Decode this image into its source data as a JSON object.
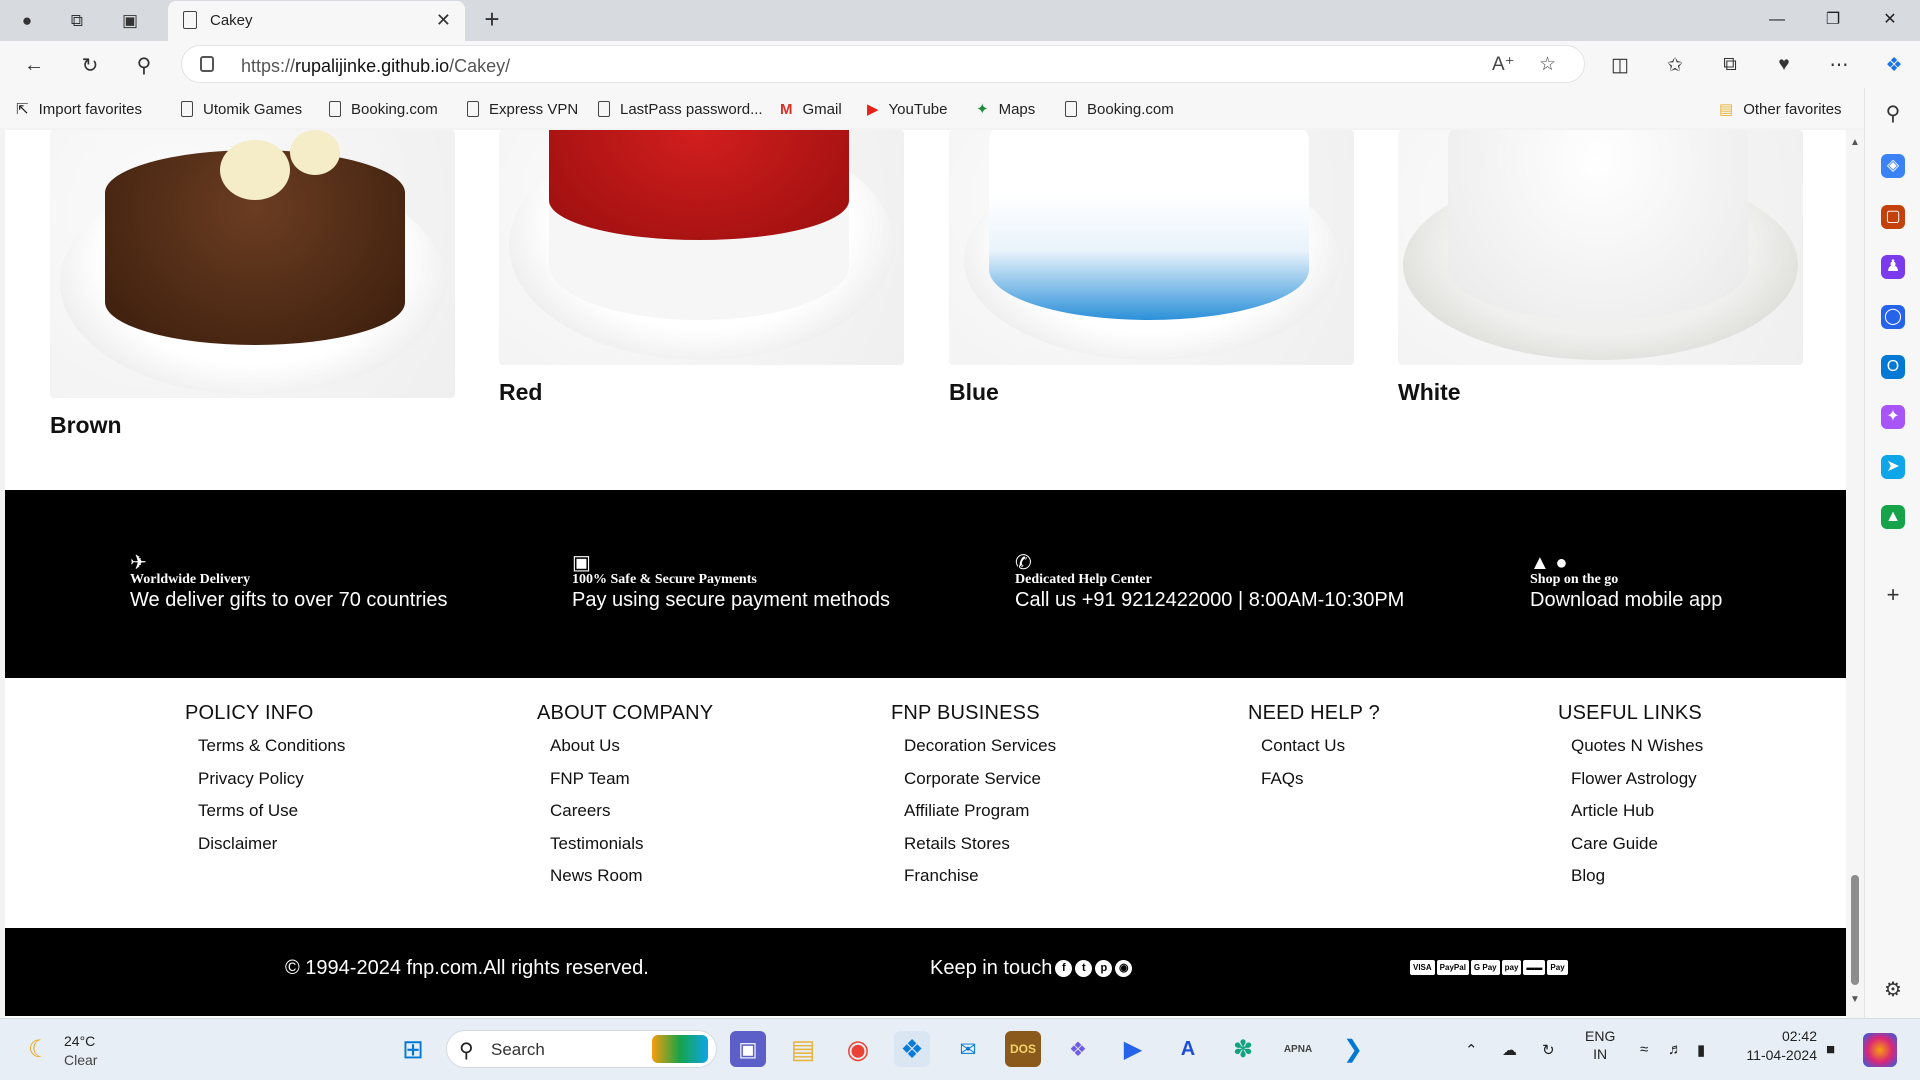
{
  "browser": {
    "tab_title": "Cakey",
    "url_prefix": "https://",
    "url_host": "rupalijinke.github.io",
    "url_path": "/Cakey/",
    "favorites": [
      "Import favorites",
      "Utomik Games",
      "Booking.com",
      "Express VPN",
      "LastPass password...",
      "Gmail",
      "YouTube",
      "Maps",
      "Booking.com"
    ],
    "other_favorites": "Other favorites"
  },
  "cakes": [
    {
      "name": "Brown"
    },
    {
      "name": "Red"
    },
    {
      "name": "Blue"
    },
    {
      "name": "White"
    }
  ],
  "features": [
    {
      "title": "Worldwide Delivery",
      "desc": "We deliver gifts to over 70 countries"
    },
    {
      "title": "100% Safe & Secure Payments",
      "desc": "Pay using secure payment methods"
    },
    {
      "title": "Dedicated Help Center",
      "desc": "Call us +91 9212422000 | 8:00AM-10:30PM"
    },
    {
      "title": "Shop on the go",
      "desc": "Download mobile app"
    }
  ],
  "footer_columns": [
    {
      "heading": "POLICY INFO",
      "links": [
        "Terms & Conditions",
        "Privacy Policy",
        "Terms of Use",
        "Disclaimer"
      ]
    },
    {
      "heading": "ABOUT COMPANY",
      "links": [
        "About Us",
        "FNP Team",
        "Careers",
        "Testimonials",
        "News Room"
      ]
    },
    {
      "heading": "FNP BUSINESS",
      "links": [
        "Decoration Services",
        "Corporate Service",
        "Affiliate Program",
        "Retails Stores",
        "Franchise"
      ]
    },
    {
      "heading": "NEED HELP ?",
      "links": [
        "Contact Us",
        "FAQs"
      ]
    },
    {
      "heading": "USEFUL LINKS",
      "links": [
        "Quotes N Wishes",
        "Flower Astrology",
        "Article Hub",
        "Care Guide",
        "Blog"
      ]
    }
  ],
  "bottom": {
    "copyright": "© 1994-2024 fnp.com.All rights reserved.",
    "keep_in_touch": "Keep in touch",
    "payment_labels": [
      "VISA",
      "PayPal",
      "G Pay",
      "pay",
      "▬▬",
      "Pay"
    ]
  },
  "taskbar": {
    "temp": "24°C",
    "condition": "Clear",
    "search": "Search",
    "lang": "ENG",
    "region": "IN",
    "time": "02:42",
    "date": "11-04-2024"
  }
}
